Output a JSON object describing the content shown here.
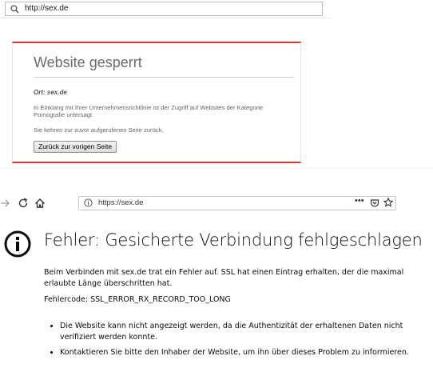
{
  "blocked_page": {
    "url": "http://sex.de",
    "title": "Website gesperrt",
    "location_line": "Ort: sex.de",
    "description": "In Einklang mit Ihrer Unternehmensrichtlinie ist der Zugriff auf Websites der Kategorie Pornografie untersagt.",
    "return_text": "Sie kehren zur zuvor aufgerufenen Seite zurück.",
    "back_button_label": "Zurück zur vorigen Seite"
  },
  "browser": {
    "url": "https://sex.de",
    "overflow_menu": "•••"
  },
  "error_page": {
    "title": "Fehler: Gesicherte Verbindung fehlgeschlagen",
    "paragraph": "Beim Verbinden mit sex.de trat ein Fehler auf. SSL hat einen Eintrag erhalten, der die maximal erlaubte Länge überschritten hat.",
    "error_code": "Fehlercode: SSL_ERROR_RX_RECORD_TOO_LONG",
    "bullets": [
      "Die Website kann nicht angezeigt werden, da die Authentizität der erhaltenen Daten nicht verifiziert werden konnte.",
      "Kontaktieren Sie bitte den Inhaber der Website, um ihn über dieses Problem zu informieren."
    ]
  },
  "colors": {
    "block_accent": "#d33a2c",
    "error_text": "#0c0c0d"
  }
}
